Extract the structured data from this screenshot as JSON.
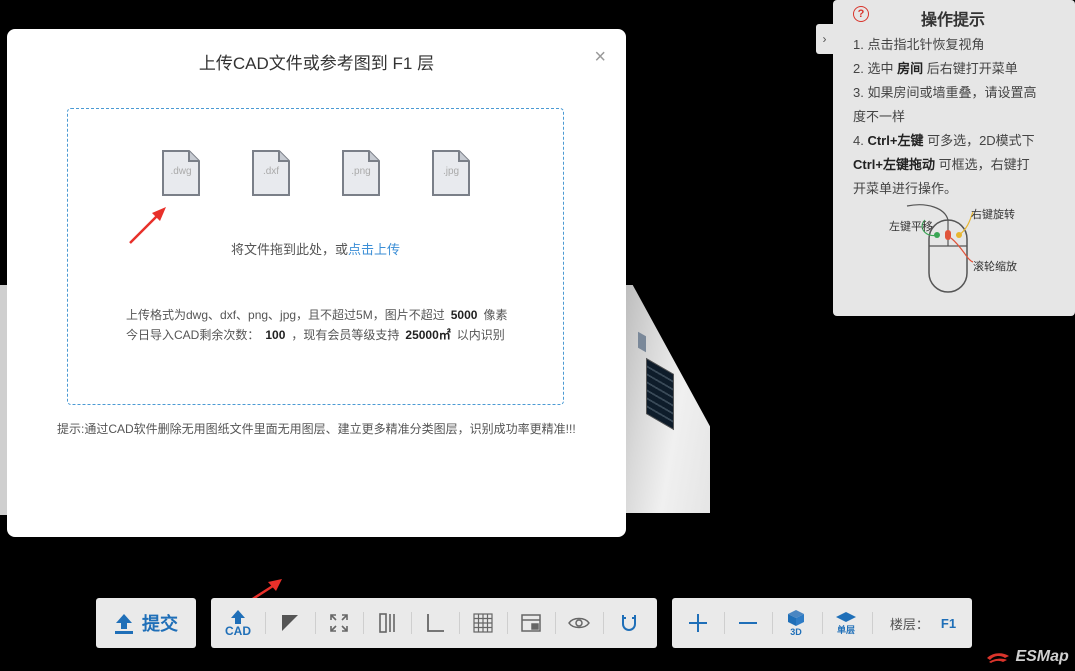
{
  "dialog": {
    "title": "上传CAD文件或参考图到 F1 层",
    "close": "×",
    "file_types": [
      ".dwg",
      ".dxf",
      ".png",
      ".jpg"
    ],
    "drop_text": "将文件拖到此处，或",
    "drop_link": "点击上传",
    "format_line": {
      "prefix": "上传格式为dwg、dxf、png、jpg，且不超过5M，图片不超过",
      "limit": "5000",
      "suffix": "像素"
    },
    "quota_line": {
      "prefix": "今日导入CAD剩余次数：",
      "count": "100",
      "middle": "，现有会员等级支持",
      "area": "25000㎡",
      "suffix": "以内识别"
    },
    "hint": "提示:通过CAD软件删除无用图纸文件里面无用图层、建立更多精准分类图层，识别成功率更精准!!!"
  },
  "help": {
    "icon": "?",
    "title": "操作提示",
    "toggle": "›",
    "item1": "1. 点击指北针恢复视角",
    "item2_a": "2. 选中 ",
    "item2_b": "房间",
    "item2_c": " 后右键打开菜单",
    "item3_a": "3. 如果房间或墙重叠，请设置高",
    "item3_b": "度不一样",
    "item4_a": "4. ",
    "item4_b": "Ctrl+左键",
    "item4_c": " 可多选，2D模式下",
    "item4_d": "Ctrl+左键拖动",
    "item4_e": " 可框选，右键打",
    "item4_f": "开菜单进行操作。",
    "mouse_left": "左键平移",
    "mouse_right": "右键旋转",
    "mouse_wheel": "滚轮缩放"
  },
  "toolbar": {
    "submit": "提交",
    "cad": "CAD",
    "btn_3d": "3D",
    "single_floor": "单层",
    "floor_label": "楼层：",
    "floor_value": "F1"
  },
  "brand": "ESMap",
  "colors": {
    "accent": "#1f6fb8",
    "link": "#3b8ed6",
    "arrow": "#e8302a",
    "panel": "#e6e6e6"
  }
}
